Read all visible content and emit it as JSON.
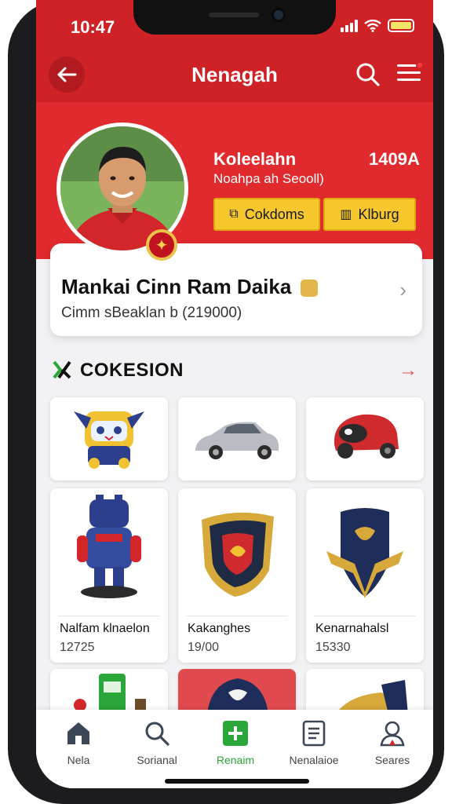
{
  "status": {
    "time": "10:47"
  },
  "header": {
    "title": "Nenagah"
  },
  "profile": {
    "name": "Koleelahn",
    "subtitle": "Noahpa ah Seooll)",
    "count": "1409A",
    "btn_primary": "Cokdoms",
    "btn_secondary": "Klburg"
  },
  "info": {
    "title": "Mankai Cinn Ram Daika",
    "subtitle": "Cimm sBeaklan b (219000)"
  },
  "section": {
    "title": "COKESION"
  },
  "items": [
    {
      "name": "",
      "value": ""
    },
    {
      "name": "",
      "value": ""
    },
    {
      "name": "",
      "value": ""
    },
    {
      "name": "Nalfam klnaelon",
      "value": "12725"
    },
    {
      "name": "Kakanghes",
      "value": "19/00"
    },
    {
      "name": "Kenarnahalsl",
      "value": "15330"
    }
  ],
  "bottom_nav": [
    {
      "label": "Nela"
    },
    {
      "label": "Sorianal"
    },
    {
      "label": "Renaim"
    },
    {
      "label": "Nenalaioe"
    },
    {
      "label": "Seares"
    }
  ],
  "colors": {
    "primary_red": "#e02a2e",
    "accent_yellow": "#f6c82e",
    "active_green": "#2ba63a"
  }
}
